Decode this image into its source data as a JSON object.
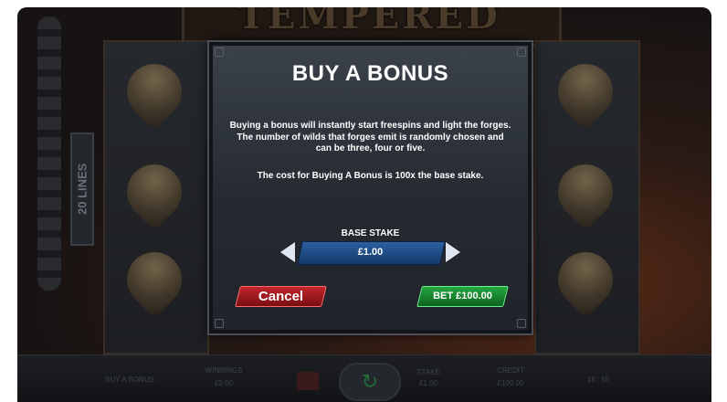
{
  "game": {
    "title": "TEMPERED STEEL",
    "lines_label": "20 LINES",
    "bottom": {
      "buy_label": "BUY A BONUS",
      "winnings_label": "WINNINGS",
      "winnings_value": "£0.00",
      "stake_label": "STAKE",
      "stake_value": "£1.00",
      "credit_label": "CREDIT",
      "credit_value": "£100.00",
      "extra_text": "18 : 55"
    }
  },
  "dialog": {
    "title": "BUY A BONUS",
    "description": "Buying a bonus will instantly start freespins and light the forges. The number of wilds that forges emit is randomly chosen and can be three, four or five.",
    "cost_text": "The cost for Buying A Bonus is 100x the base stake.",
    "stake_label": "BASE STAKE",
    "stake_value": "£1.00",
    "cancel_label": "Cancel",
    "bet_label": "BET £100.00"
  },
  "colors": {
    "cancel": "#c0262c",
    "bet": "#25a640",
    "stake": "#2c5fa0"
  }
}
